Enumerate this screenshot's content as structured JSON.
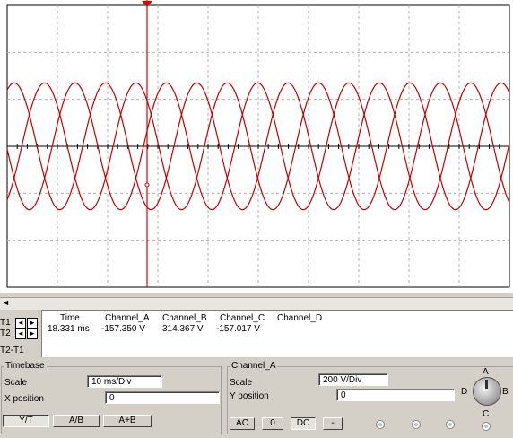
{
  "colors": {
    "trace": "#c00000",
    "cursor": "#e00000",
    "grid": "#b0b0b0"
  },
  "readout": {
    "t1_label": "T1",
    "t2_label": "T2",
    "diff_label": "T2-T1",
    "headers": [
      "Time",
      "Channel_A",
      "Channel_B",
      "Channel_C",
      "Channel_D"
    ],
    "t1_values": [
      "18.331 ms",
      "-157.350 V",
      "314.367 V",
      "-157.017 V",
      ""
    ]
  },
  "timebase": {
    "title": "Timebase",
    "scale_label": "Scale",
    "scale_value": "10 ms/Div",
    "xpos_label": "X position",
    "xpos_value": "0",
    "buttons": [
      "Y/T",
      "A/B",
      "A+B"
    ],
    "selected": "Y/T"
  },
  "channel_a": {
    "title": "Channel_A",
    "scale_label": "Scale",
    "scale_value": "200  V/Div",
    "ypos_label": "Y position",
    "ypos_value": "0",
    "coupling": [
      "AC",
      "0",
      "DC",
      "-"
    ],
    "selected_coupling": "DC"
  },
  "channel_selector": {
    "labels": [
      "A",
      "B",
      "C",
      "D"
    ]
  },
  "scrollbar": {
    "left_arrow": "◄"
  },
  "icons": {
    "cursor_marker": "cursor-triangle-icon",
    "knob": "channel-knob-icon"
  }
}
